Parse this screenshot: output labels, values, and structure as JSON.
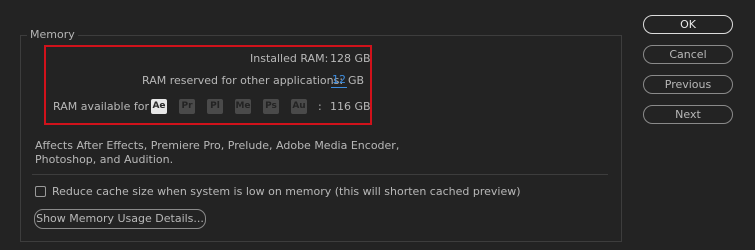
{
  "memory": {
    "group_label": "Memory",
    "installed_ram_label": "Installed RAM:",
    "installed_ram_value": "128 GB",
    "reserved_label": "RAM reserved for other applications:",
    "reserved_value": "12",
    "reserved_unit": "GB",
    "available_label": "RAM available for",
    "available_colon": ":",
    "available_value": "116 GB",
    "apps": [
      {
        "label": "Ae",
        "icon": "after-effects-icon",
        "active": true
      },
      {
        "label": "Pr",
        "icon": "premiere-pro-icon",
        "active": false
      },
      {
        "label": "Pl",
        "icon": "prelude-icon",
        "active": false
      },
      {
        "label": "Me",
        "icon": "media-encoder-icon",
        "active": false
      },
      {
        "label": "Ps",
        "icon": "photoshop-icon",
        "active": false
      },
      {
        "label": "Au",
        "icon": "audition-icon",
        "active": false
      }
    ],
    "affects_line1": "Affects After Effects, Premiere Pro, Prelude, Adobe Media Encoder,",
    "affects_line2": "Photoshop, and Audition.",
    "reduce_cache_label": "Reduce cache size when system is low on memory (this will shorten cached preview)",
    "reduce_cache_checked": false,
    "show_details_button": "Show Memory Usage Details..."
  },
  "buttons": {
    "ok": "OK",
    "cancel": "Cancel",
    "previous": "Previous",
    "next": "Next"
  },
  "colors": {
    "highlight_border": "#d0121b",
    "link_blue": "#3e8ee0",
    "background": "#232323"
  }
}
